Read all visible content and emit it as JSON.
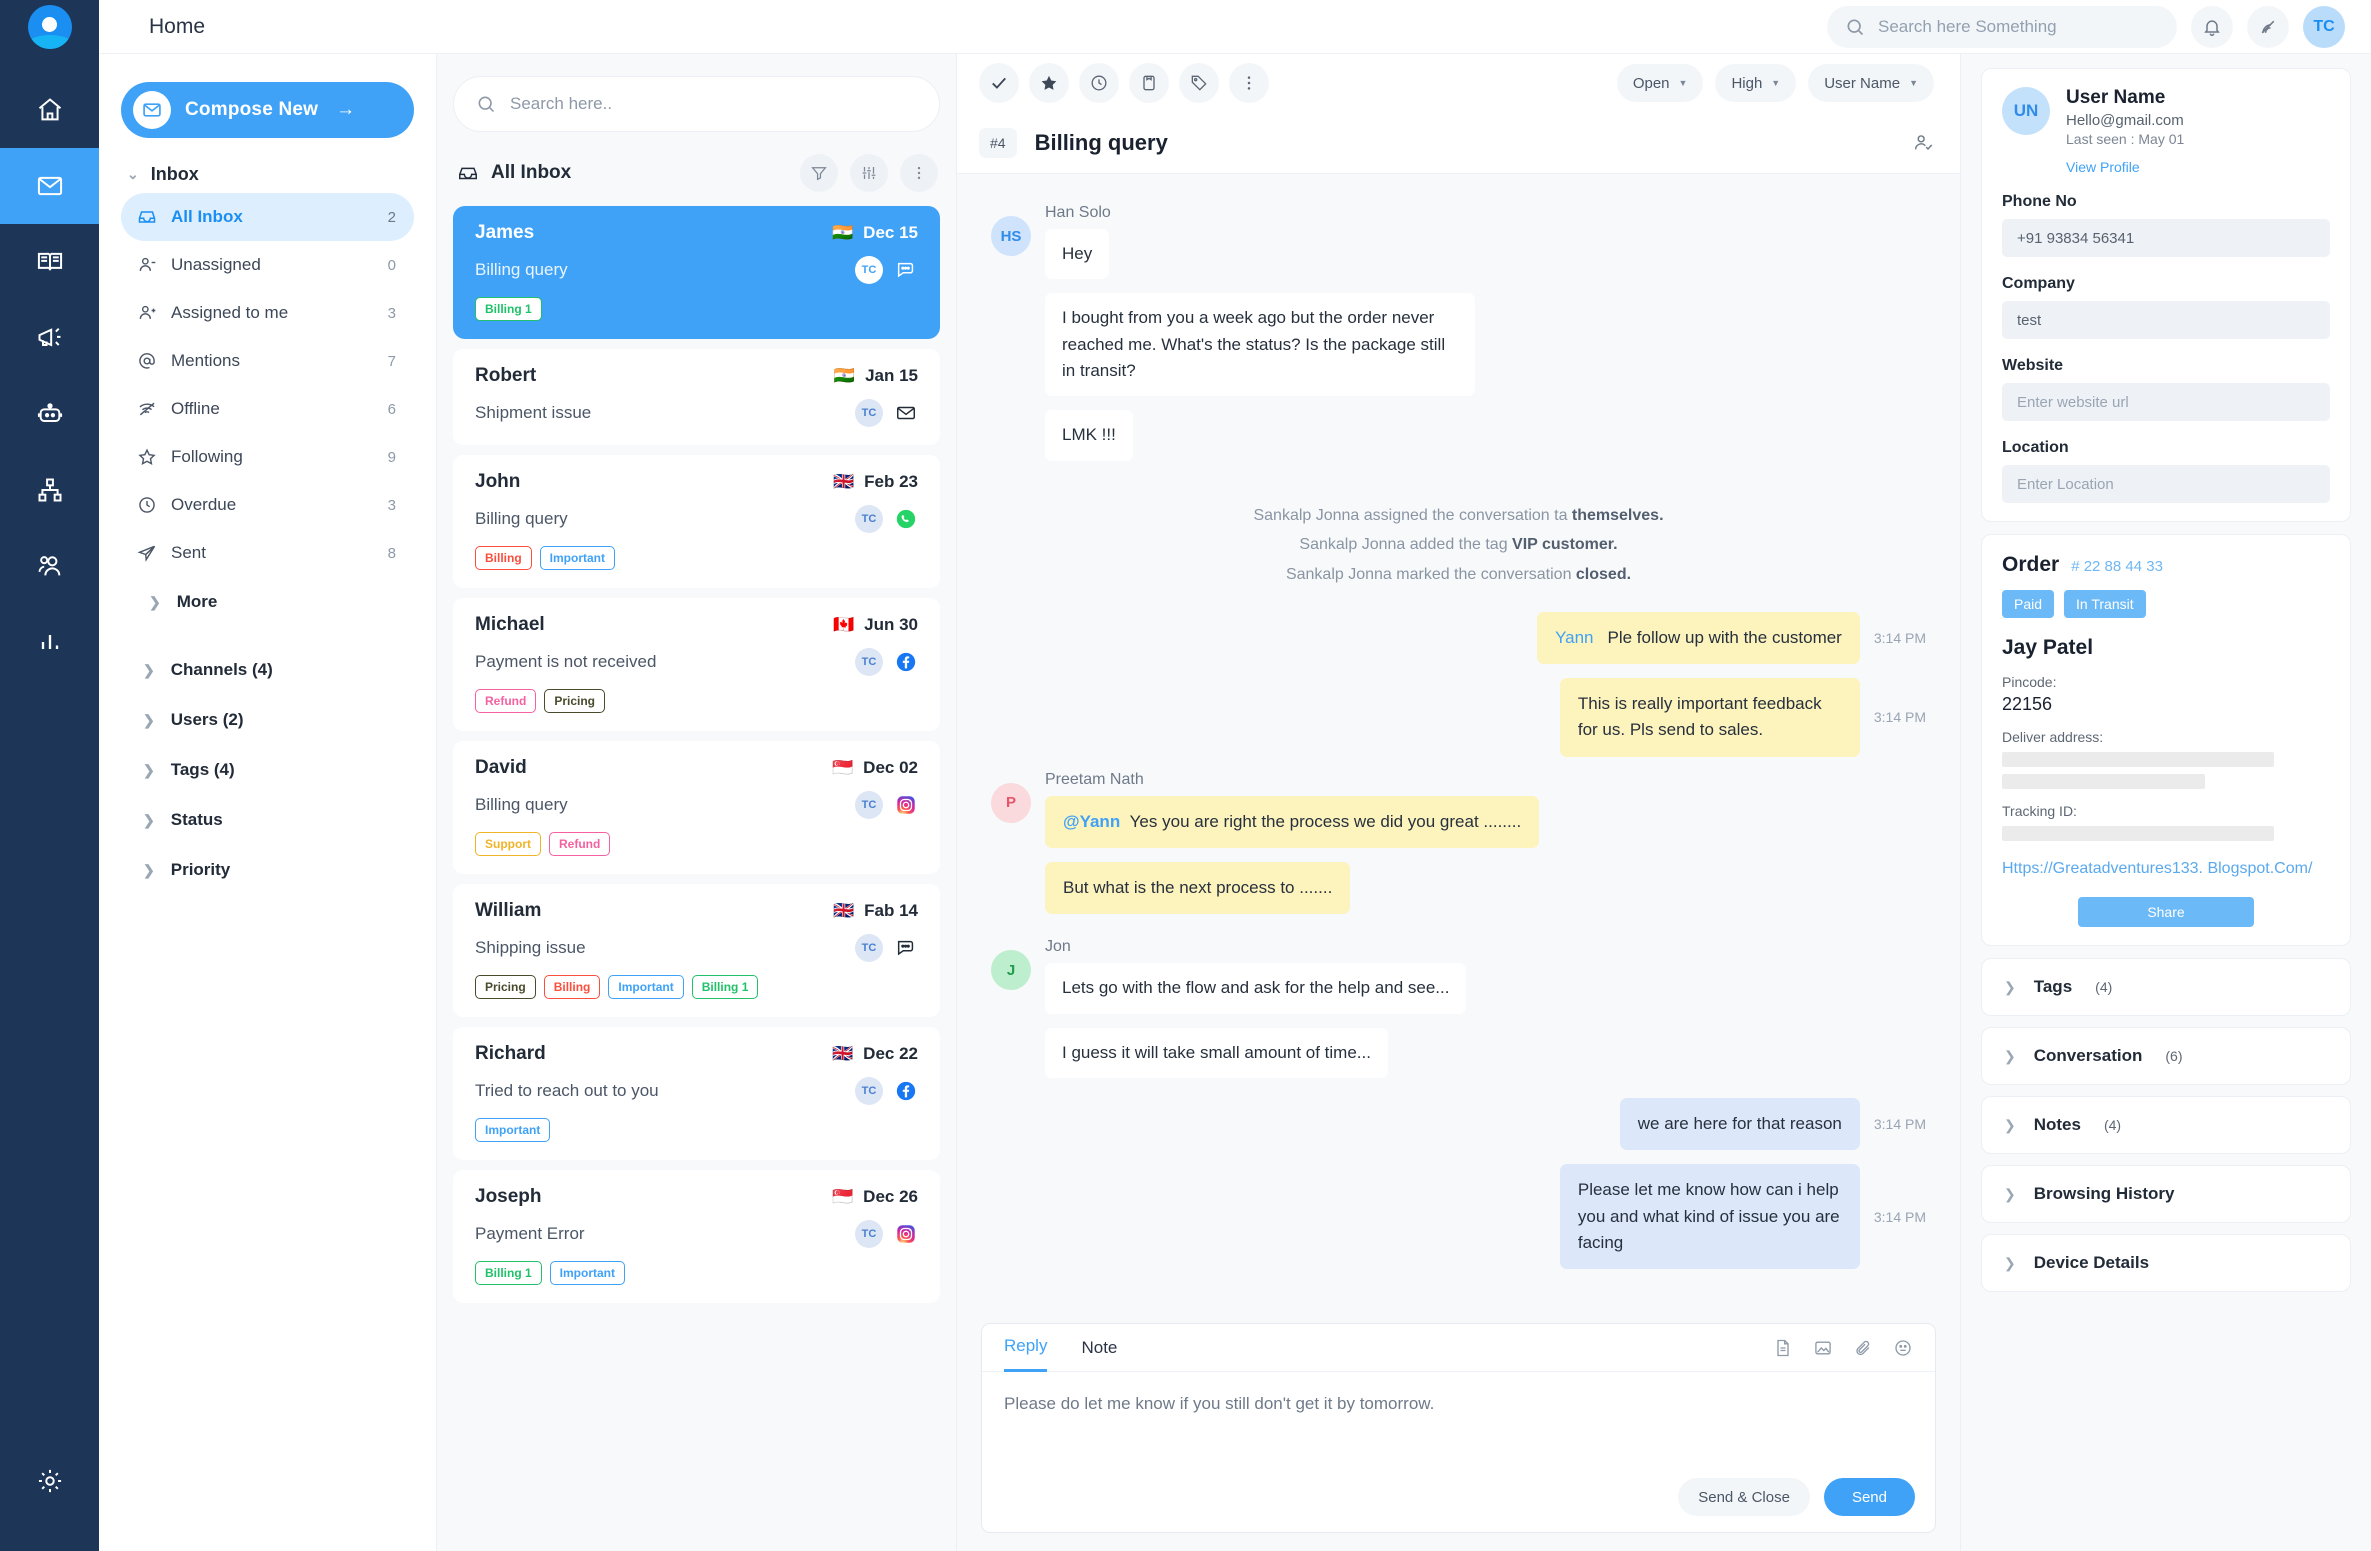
{
  "topbar": {
    "breadcrumb": "Home",
    "search_placeholder": "Search here Something",
    "search_value": "",
    "notification_icon": "bell-icon",
    "broadcast_icon": "signal-icon",
    "avatar_initials": "TC"
  },
  "rail": {
    "items": [
      {
        "name": "home",
        "icon": "home-icon",
        "active": false
      },
      {
        "name": "inbox",
        "icon": "mail-icon",
        "active": true
      },
      {
        "name": "knowledge-base",
        "icon": "book-icon",
        "active": false
      },
      {
        "name": "campaigns",
        "icon": "megaphone-icon",
        "active": false
      },
      {
        "name": "bots",
        "icon": "robot-icon",
        "active": false
      },
      {
        "name": "workflows",
        "icon": "sitemap-icon",
        "active": false
      },
      {
        "name": "contacts",
        "icon": "people-icon",
        "active": false
      },
      {
        "name": "reports",
        "icon": "chart-icon",
        "active": false
      }
    ],
    "settings_icon": "gear-icon"
  },
  "sidebar": {
    "compose_label": "Compose New",
    "compose_arrow": "→",
    "inbox_group": "Inbox",
    "folders": [
      {
        "label": "All Inbox",
        "count": "2",
        "icon": "inbox-icon",
        "active": true
      },
      {
        "label": "Unassigned",
        "count": "0",
        "icon": "user-minus-icon",
        "active": false
      },
      {
        "label": "Assigned to me",
        "count": "3",
        "icon": "user-plus-icon",
        "active": false
      },
      {
        "label": "Mentions",
        "count": "7",
        "icon": "at-icon",
        "active": false
      },
      {
        "label": "Offline",
        "count": "6",
        "icon": "wifi-off-icon",
        "active": false
      },
      {
        "label": "Following",
        "count": "9",
        "icon": "star-icon",
        "active": false
      },
      {
        "label": "Overdue",
        "count": "3",
        "icon": "clock-icon",
        "active": false
      },
      {
        "label": "Sent",
        "count": "8",
        "icon": "send-icon",
        "active": false
      }
    ],
    "more_label": "More",
    "sections": [
      {
        "label": "Channels (4)"
      },
      {
        "label": "Users (2)"
      },
      {
        "label": "Tags (4)"
      },
      {
        "label": "Status"
      },
      {
        "label": "Priority"
      }
    ]
  },
  "convlist": {
    "search_placeholder": "Search here..",
    "search_value": "",
    "header_title": "All Inbox",
    "header_icon": "inbox-icon",
    "filter_icon": "filter-icon",
    "sort_icon": "sliders-icon",
    "more_icon": "dots-vertical-icon",
    "items": [
      {
        "name": "James",
        "flag": "🇮🇳",
        "date": "Dec 15",
        "subject": "Billing query",
        "assignee": "TC",
        "channel": "chat-icon",
        "selected": true,
        "tags": [
          {
            "label": "Billing 1",
            "color": "#21c06a"
          }
        ]
      },
      {
        "name": "Robert",
        "flag": "🇮🇳",
        "date": "Jan 15",
        "subject": "Shipment issue",
        "assignee": "TC",
        "channel": "email-icon",
        "selected": false,
        "tags": []
      },
      {
        "name": "John",
        "flag": "🇬🇧",
        "date": "Feb 23",
        "subject": "Billing query",
        "assignee": "TC",
        "channel": "whatsapp-icon",
        "selected": false,
        "tags": [
          {
            "label": "Billing",
            "color": "#fb4e3d"
          },
          {
            "label": "Important",
            "color": "#3fa2f7"
          }
        ]
      },
      {
        "name": "Michael",
        "flag": "🇨🇦",
        "date": "Jun 30",
        "subject": "Payment is not received",
        "assignee": "TC",
        "channel": "facebook-icon",
        "selected": false,
        "tags": [
          {
            "label": "Refund",
            "color": "#f561a0"
          },
          {
            "label": "Pricing",
            "color": "#4a4a2c"
          }
        ]
      },
      {
        "name": "David",
        "flag": "🇸🇬",
        "date": "Dec 02",
        "subject": "Billing query",
        "assignee": "TC",
        "channel": "instagram-icon",
        "selected": false,
        "tags": [
          {
            "label": "Support",
            "color": "#f0b429"
          },
          {
            "label": "Refund",
            "color": "#f561a0"
          }
        ]
      },
      {
        "name": "William",
        "flag": "🇬🇧",
        "date": "Fab 14",
        "subject": "Shipping issue",
        "assignee": "TC",
        "channel": "chat-icon",
        "selected": false,
        "tags": [
          {
            "label": "Pricing",
            "color": "#4a4a2c"
          },
          {
            "label": "Billing",
            "color": "#fb4e3d"
          },
          {
            "label": "Important",
            "color": "#3fa2f7"
          },
          {
            "label": "Billing 1",
            "color": "#21c06a"
          }
        ]
      },
      {
        "name": "Richard",
        "flag": "🇬🇧",
        "date": "Dec 22",
        "subject": "Tried to reach out to you",
        "assignee": "TC",
        "channel": "facebook-icon",
        "selected": false,
        "tags": [
          {
            "label": "Important",
            "color": "#3fa2f7"
          }
        ]
      },
      {
        "name": "Joseph",
        "flag": "🇸🇬",
        "date": "Dec 26",
        "subject": "Payment Error",
        "assignee": "TC",
        "channel": "instagram-icon",
        "selected": false,
        "tags": [
          {
            "label": "Billing 1",
            "color": "#21c06a"
          },
          {
            "label": "Important",
            "color": "#3fa2f7"
          }
        ]
      }
    ]
  },
  "thread": {
    "tools": [
      {
        "name": "resolve",
        "icon": "check-icon"
      },
      {
        "name": "star",
        "icon": "star-filled-icon"
      },
      {
        "name": "snooze",
        "icon": "clock-icon"
      },
      {
        "name": "archive",
        "icon": "folder-icon"
      },
      {
        "name": "tag",
        "icon": "tag-icon"
      },
      {
        "name": "more",
        "icon": "dots-vertical-icon"
      }
    ],
    "status_pill": "Open",
    "priority_pill": "High",
    "assignee_pill": "User Name",
    "number": "#4",
    "title": "Billing query",
    "assign_icon": "user-check-icon",
    "groups": [
      {
        "author": "Han Solo",
        "initials": "HS",
        "avatar_bg": "#cfe3fd",
        "avatar_fg": "#2f8ce8",
        "side": "left",
        "kind": "plain",
        "messages": [
          {
            "text": "Hey"
          },
          {
            "text": "I bought from you a week ago but the order never reached me. What's the status? Is the package still in transit?"
          },
          {
            "text": "LMK !!!"
          }
        ]
      }
    ],
    "system_lines": [
      {
        "prefix": "Sankalp Jonna assigned the conversation ta ",
        "strong": "themselves."
      },
      {
        "prefix": "Sankalp Jonna added the tag ",
        "strong": "VIP customer."
      },
      {
        "prefix": "Sankalp Jonna marked the conversation ",
        "strong": "closed."
      }
    ],
    "note_right_1": {
      "mention": "Yann",
      "text": "Ple follow up with the customer",
      "time": "3:14 PM"
    },
    "note_right_2": {
      "text": "This is really important feedback for us. Pls send to sales.",
      "time": "3:14 PM"
    },
    "preetam": {
      "author": "Preetam Nath",
      "initials": "P",
      "avatar_bg": "#fadadd",
      "avatar_fg": "#e8546a",
      "messages": [
        {
          "mention": "@Yann",
          "text": "Yes you are right the process we did you great ........"
        },
        {
          "mention": "",
          "text": "But what is the next process to ......."
        }
      ]
    },
    "jon": {
      "author": "Jon",
      "initials": "J",
      "avatar_bg": "#bdeecd",
      "avatar_fg": "#1f9d4d",
      "messages": [
        {
          "text": "Lets go with the flow and ask for the help and see..."
        },
        {
          "text": "I guess it will take small amount of time..."
        }
      ]
    },
    "agent_replies": [
      {
        "text": "we are here for that reason",
        "time": "3:14 PM"
      },
      {
        "text": "Please let me know how can i help you and what kind of issue you are facing",
        "time": "3:14 PM"
      }
    ]
  },
  "reply": {
    "tab_reply": "Reply",
    "tab_note": "Note",
    "tools": [
      {
        "name": "canned-response",
        "icon": "document-icon"
      },
      {
        "name": "insert-image",
        "icon": "image-icon"
      },
      {
        "name": "attach-file",
        "icon": "paperclip-icon"
      },
      {
        "name": "emoji",
        "icon": "emoji-icon"
      }
    ],
    "draft_text": "Please do let me know if you still don't get it by tomorrow.",
    "send_close_label": "Send & Close",
    "send_label": "Send"
  },
  "rightpanel": {
    "user": {
      "initials": "UN",
      "name": "User Name",
      "email": "Hello@gmail.com",
      "last_seen": "Last seen : May 01",
      "view_profile": "View Profile"
    },
    "fields": [
      {
        "label": "Phone No",
        "value": "+91 93834 56341",
        "placeholder": ""
      },
      {
        "label": "Company",
        "value": "test",
        "placeholder": ""
      },
      {
        "label": "Website",
        "value": "",
        "placeholder": "Enter website url"
      },
      {
        "label": "Location",
        "value": "",
        "placeholder": "Enter Location"
      }
    ],
    "order": {
      "title": "Order",
      "number": "# 22 88 44 33",
      "badges": [
        "Paid",
        "In Transit"
      ],
      "customer_name": "Jay Patel",
      "pincode_label": "Pincode:",
      "pincode_value": "22156",
      "address_label": "Deliver address:",
      "tracking_label": "Tracking ID:",
      "link": "Https://Greatadventures133. Blogspot.Com/",
      "share_label": "Share"
    },
    "accordions": [
      {
        "label": "Tags",
        "count": "(4)"
      },
      {
        "label": "Conversation",
        "count": "(6)"
      },
      {
        "label": "Notes",
        "count": "(4)"
      },
      {
        "label": "Browsing History",
        "count": ""
      },
      {
        "label": "Device Details",
        "count": ""
      }
    ]
  }
}
